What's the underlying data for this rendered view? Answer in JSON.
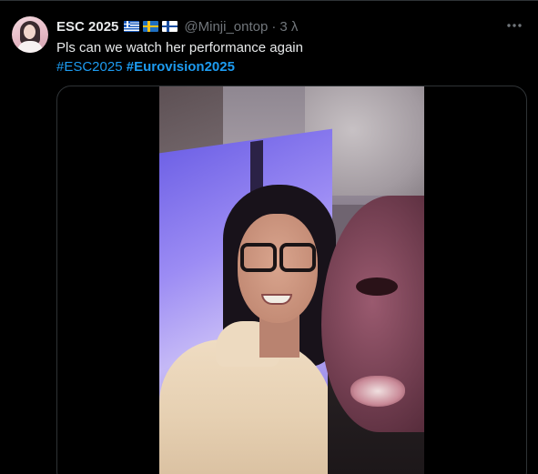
{
  "tweet": {
    "author_name": "ESC 2025",
    "flags": [
      "greece-flag",
      "sweden-flag",
      "finland-flag"
    ],
    "handle": "@Minji_ontop",
    "separator": "·",
    "time": "3 λ",
    "text": "Pls can we watch her performance again",
    "hashtags": [
      "#ESC2025",
      "#Eurovision2025"
    ]
  },
  "media": {
    "type": "video",
    "description_icon": "video-thumbnail"
  },
  "colors": {
    "background": "#000000",
    "text_primary": "#e7e9ea",
    "text_secondary": "#71767b",
    "link": "#1d9bf0",
    "border": "#2f3336"
  }
}
